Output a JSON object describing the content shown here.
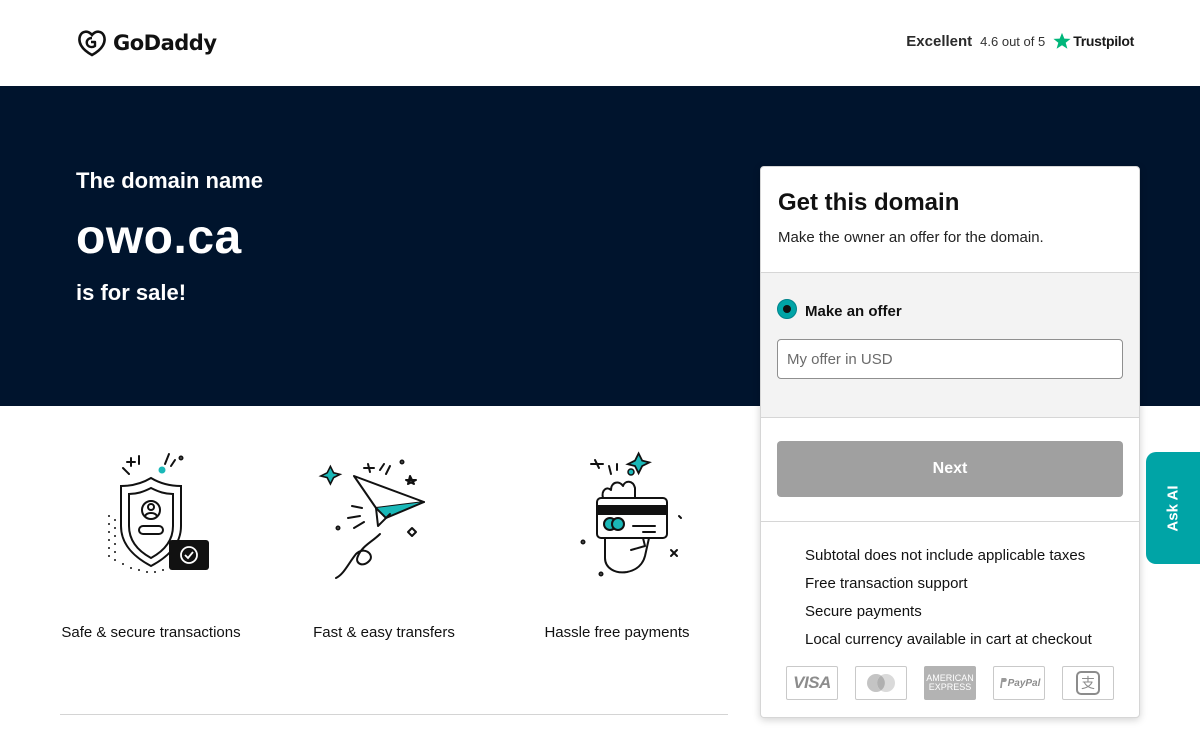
{
  "header": {
    "logo_text": "GoDaddy",
    "rating_label": "Excellent",
    "rating_score": "4.6 out of 5",
    "trustpilot_label": "Trustpilot"
  },
  "hero": {
    "subtitle": "The domain name",
    "domain": "owo.ca",
    "status": "is for sale!"
  },
  "features": [
    {
      "icon": "shield-lock-icon",
      "label": "Safe & secure transactions"
    },
    {
      "icon": "paper-plane-icon",
      "label": "Fast & easy transfers"
    },
    {
      "icon": "card-payment-icon",
      "label": "Hassle free payments"
    }
  ],
  "card": {
    "title": "Get this domain",
    "description": "Make the owner an offer for the domain.",
    "option_label": "Make an offer",
    "offer_placeholder": "My offer in USD",
    "offer_value": "",
    "next_label": "Next",
    "benefits": [
      "Subtotal does not include applicable taxes",
      "Free transaction support",
      "Secure payments",
      "Local currency available in cart at checkout"
    ],
    "payment_methods": [
      "visa",
      "mastercard",
      "amex",
      "paypal",
      "alipay"
    ],
    "visa_text": "VISA",
    "amex_text_1": "AMERICAN",
    "amex_text_2": "EXPRESS",
    "paypal_text": "PayPal",
    "alipay_text": "支"
  },
  "ask_ai_label": "Ask AI",
  "colors": {
    "hero_bg": "#00142d",
    "accent_teal": "#00a4a6",
    "trustpilot_green": "#00b67a",
    "button_disabled": "#a0a0a0"
  }
}
